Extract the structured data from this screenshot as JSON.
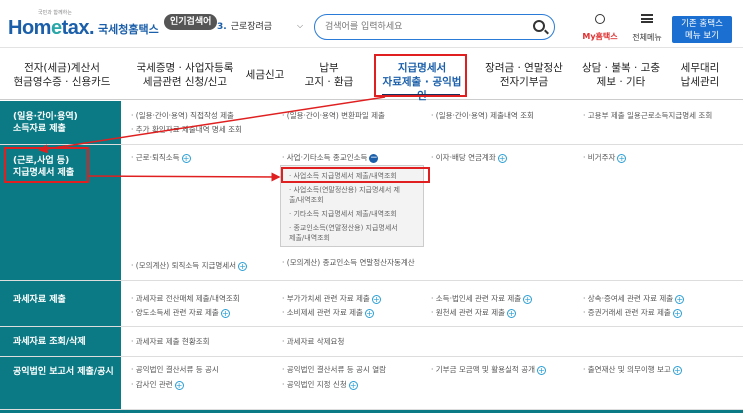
{
  "header": {
    "logo_small": "국민과 함께하는",
    "logo_main_a": "Hom",
    "logo_main_e": "e",
    "logo_main_b": "tax.",
    "logo_sub": "국세청홈택스",
    "popular_label": "인기검색어",
    "keyword_num": "3.",
    "keyword_text": "근로장려금",
    "search_placeholder": "검색어를 입력하세요",
    "my_label": "My홈택스",
    "menu_label": "전체메뉴",
    "old_view_line1": "기존 홈택스",
    "old_view_line2": "메뉴 보기"
  },
  "gnb": [
    {
      "l1": "전자(세금)계산서",
      "l2": "현금영수증 · 신용카드"
    },
    {
      "l1": "국세증명 · 사업자등록",
      "l2": "세금관련 신청/신고"
    },
    {
      "l1": "세금신고",
      "l2": ""
    },
    {
      "l1": "납부",
      "l2": "고지 · 환급"
    },
    {
      "l1": "지급명세서",
      "l2": "자료제출 · 공익법인"
    },
    {
      "l1": "장려금 · 연말정산",
      "l2": "전자기부금"
    },
    {
      "l1": "상담 · 불복 · 고충",
      "l2": "제보 · 기타"
    },
    {
      "l1": "세무대리",
      "l2": "납세관리"
    }
  ],
  "rows": {
    "r1": {
      "l1": "(일용·간이·용역)",
      "l2": "소득자료 제출"
    },
    "r2": {
      "l1": "(근로,사업 등)",
      "l2": "지급명세서 제출"
    },
    "r3": {
      "l1": "과세자료 제출"
    },
    "r4": {
      "l1": "과세자료 조회/삭제"
    },
    "r5": {
      "l1": "공익법인 보고서 제출/공시"
    }
  },
  "cells": {
    "r1c1a": "· (일용·간이·용역) 직접작성 제출",
    "r1c1b": "· 추가 확인자료 제출내역 명세 조회",
    "r1c2": "· (일용·간이·용역) 변환파일 제출",
    "r1c3": "· (일용·간이·용역) 제출내역 조회",
    "r1c4": "· 고용부 제출 일용근로소득지급명세 조회",
    "r2c1": "· 근로·퇴직소득",
    "r2c2": "· 사업·기타소득 종교인소득",
    "r2c3": "· 이자·배당 연금계좌",
    "r2c4": "· 비거주자",
    "sub1": "· 사업소득 지급명세서 제출/내역조회",
    "sub2a": "· 사업소득(연말정산용) 지급명세서 제",
    "sub2b": "출/내역조회",
    "sub3": "· 기타소득 지급명세서 제출/내역조회",
    "sub4a": "· 종교인소득(연말정산용) 지급명세서",
    "sub4b": "제출/내역조회",
    "r2c1b": "· (모의계산) 퇴직소득 지급명세서",
    "r2c2b": "· (모의계산) 종교인소득 연말정산자동계산",
    "r3c1a": "· 과세자료 전산매체 제출/내역조회",
    "r3c1b": "· 양도소득세 관련 자료 제출",
    "r3c2a": "· 부가가치세 관련 자료 제출",
    "r3c2b": "· 소비제세 관련 자료 제출",
    "r3c3a": "· 소득·법인세 관련 자료 제출",
    "r3c3b": "· 원천세 관련 자료 제출",
    "r3c4a": "· 상속·증여세 관련 자료 제출",
    "r3c4b": "· 증권거래세 관련 자료 제출",
    "r4c1": "· 과세자료 제출 현황조회",
    "r4c2": "· 과세자료 삭제요청",
    "r5c1a": "· 공익법인 결산서류 등 공시",
    "r5c1b": "· 감사인 관련",
    "r5c2a": "· 공익법인 결산서류 등 공시 열람",
    "r5c2b": "· 공익법인 지정 신청",
    "r5c3": "· 기부금 모금액 및 활용실적 공개",
    "r5c4": "· 출연재산 및 의무이행 보고"
  },
  "colors": {
    "accent": "#1b5faa",
    "sidebar": "#0b7a85",
    "highlight": "#e02020"
  }
}
